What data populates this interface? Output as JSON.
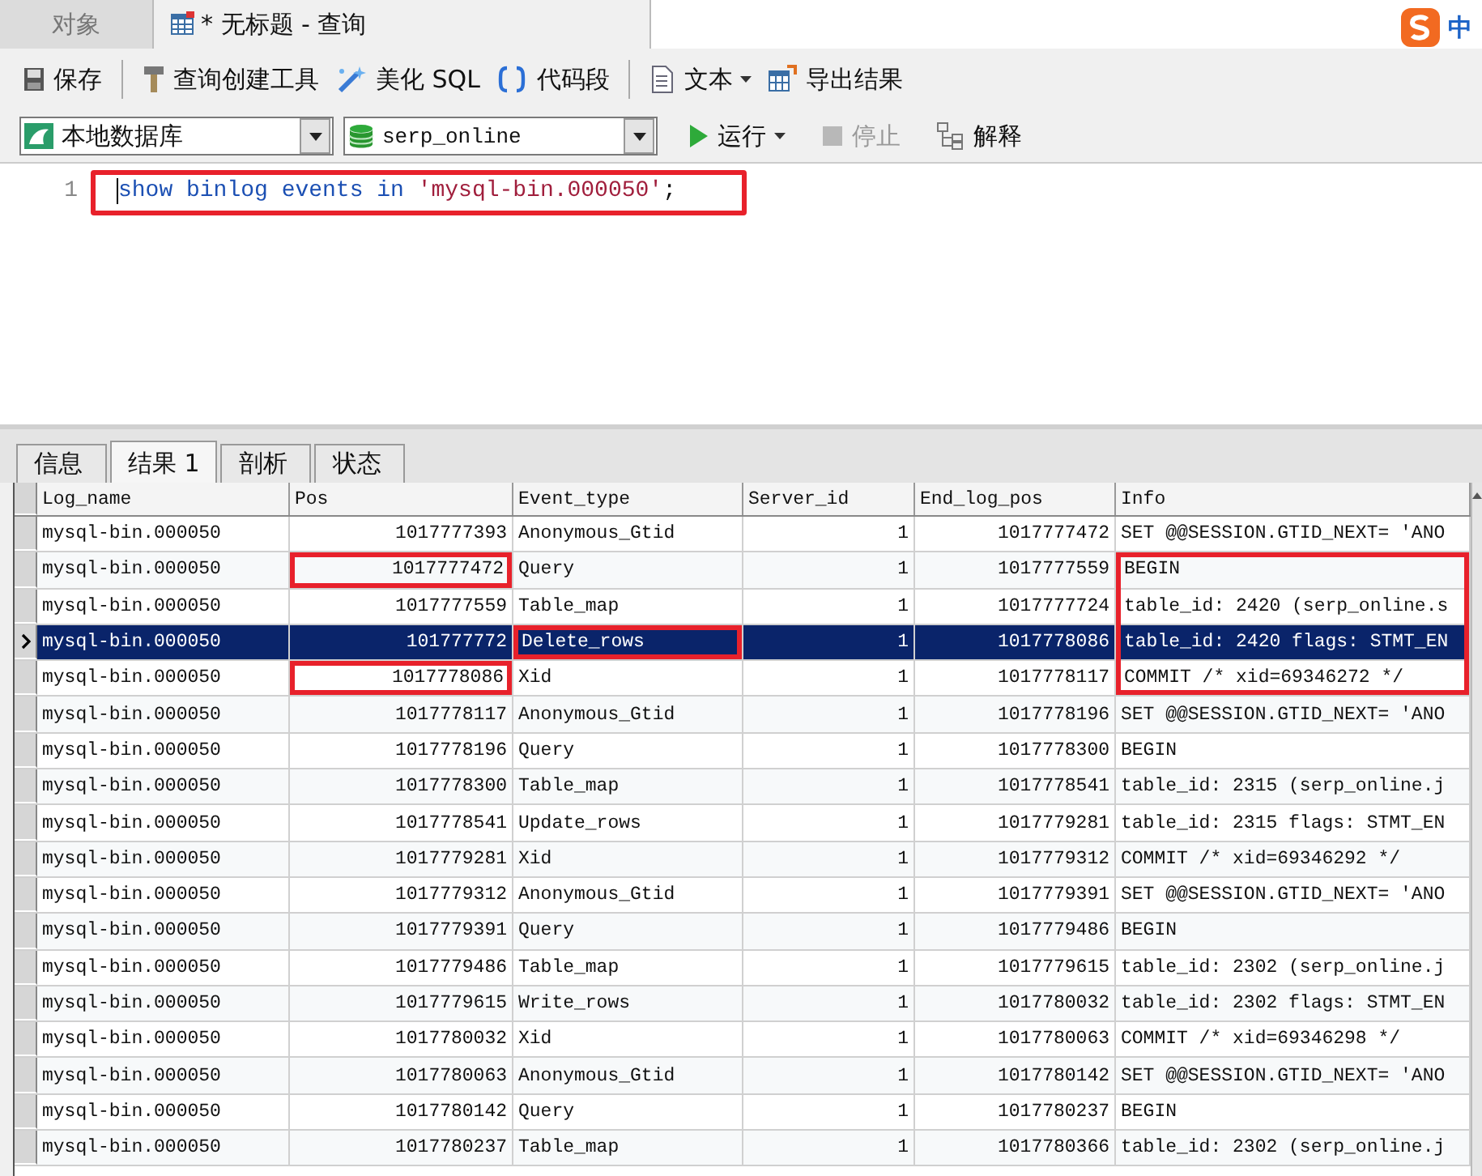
{
  "window_tabs": [
    {
      "label": "对象",
      "kind": "plain",
      "selected": false
    },
    {
      "label": "* 无标题 - 查询",
      "kind": "query",
      "selected": true
    }
  ],
  "ime": {
    "label": "中"
  },
  "toolbar": [
    {
      "kind": "save",
      "label": "保存"
    },
    {
      "kind": "builder",
      "label": "查询创建工具"
    },
    {
      "kind": "beautify",
      "label": "美化 SQL"
    },
    {
      "kind": "snippet",
      "label": "代码段"
    },
    {
      "kind": "text",
      "label": "文本",
      "dropdown": true
    },
    {
      "kind": "export",
      "label": "导出结果"
    }
  ],
  "connection": {
    "value": "本地数据库"
  },
  "database": {
    "value": "serp_online"
  },
  "run_bar": [
    {
      "kind": "run",
      "label": "运行",
      "dropdown": true,
      "disabled": false
    },
    {
      "kind": "stop",
      "label": "停止",
      "dropdown": false,
      "disabled": true
    },
    {
      "kind": "explain",
      "label": "解释",
      "dropdown": false,
      "disabled": false
    }
  ],
  "editor": {
    "lines": [
      {
        "number": "1",
        "annotated": true,
        "tokens": [
          {
            "kind": "keyword",
            "text": "show binlog events in "
          },
          {
            "kind": "string",
            "text": "'mysql-bin.000050'"
          },
          {
            "kind": "plain",
            "text": ";"
          }
        ]
      }
    ]
  },
  "result_tabs": [
    {
      "label": "信息",
      "selected": false
    },
    {
      "label": "结果 1",
      "selected": true
    },
    {
      "label": "剖析",
      "selected": false
    },
    {
      "label": "状态",
      "selected": false
    }
  ],
  "table": {
    "columns": [
      {
        "label": "Log_name",
        "kind": "text"
      },
      {
        "label": "Pos",
        "kind": "number"
      },
      {
        "label": "Event_type",
        "kind": "text"
      },
      {
        "label": "Server_id",
        "kind": "number"
      },
      {
        "label": "End_log_pos",
        "kind": "number"
      },
      {
        "label": "Info",
        "kind": "text"
      }
    ],
    "rows": [
      {
        "cells": [
          "mysql-bin.000050",
          "1017777393",
          "Anonymous_Gtid",
          "1",
          "1017777472",
          "SET @@SESSION.GTID_NEXT= 'ANO"
        ],
        "selected": false,
        "marked": [
          false,
          false,
          false,
          false,
          false,
          false
        ]
      },
      {
        "cells": [
          "mysql-bin.000050",
          "1017777472",
          "Query",
          "1",
          "1017777559",
          "BEGIN"
        ],
        "selected": false,
        "marked": [
          false,
          true,
          false,
          false,
          false,
          true
        ]
      },
      {
        "cells": [
          "mysql-bin.000050",
          "1017777559",
          "Table_map",
          "1",
          "1017777724",
          "table_id: 2420 (serp_online.s"
        ],
        "selected": false,
        "marked": [
          false,
          false,
          false,
          false,
          false,
          true
        ]
      },
      {
        "cells": [
          "mysql-bin.000050",
          "101777772",
          "Delete_rows",
          "1",
          "1017778086",
          "table_id: 2420 flags: STMT_EN"
        ],
        "selected": true,
        "marked": [
          false,
          false,
          true,
          false,
          false,
          true
        ]
      },
      {
        "cells": [
          "mysql-bin.000050",
          "1017778086",
          "Xid",
          "1",
          "1017778117",
          "COMMIT /* xid=69346272 */"
        ],
        "selected": false,
        "marked": [
          false,
          true,
          false,
          false,
          false,
          true
        ]
      },
      {
        "cells": [
          "mysql-bin.000050",
          "1017778117",
          "Anonymous_Gtid",
          "1",
          "1017778196",
          "SET @@SESSION.GTID_NEXT= 'ANO"
        ],
        "selected": false,
        "marked": [
          false,
          false,
          false,
          false,
          false,
          false
        ]
      },
      {
        "cells": [
          "mysql-bin.000050",
          "1017778196",
          "Query",
          "1",
          "1017778300",
          "BEGIN"
        ],
        "selected": false,
        "marked": [
          false,
          false,
          false,
          false,
          false,
          false
        ]
      },
      {
        "cells": [
          "mysql-bin.000050",
          "1017778300",
          "Table_map",
          "1",
          "1017778541",
          "table_id: 2315 (serp_online.j"
        ],
        "selected": false,
        "marked": [
          false,
          false,
          false,
          false,
          false,
          false
        ]
      },
      {
        "cells": [
          "mysql-bin.000050",
          "1017778541",
          "Update_rows",
          "1",
          "1017779281",
          "table_id: 2315 flags: STMT_EN"
        ],
        "selected": false,
        "marked": [
          false,
          false,
          false,
          false,
          false,
          false
        ]
      },
      {
        "cells": [
          "mysql-bin.000050",
          "1017779281",
          "Xid",
          "1",
          "1017779312",
          "COMMIT /* xid=69346292 */"
        ],
        "selected": false,
        "marked": [
          false,
          false,
          false,
          false,
          false,
          false
        ]
      },
      {
        "cells": [
          "mysql-bin.000050",
          "1017779312",
          "Anonymous_Gtid",
          "1",
          "1017779391",
          "SET @@SESSION.GTID_NEXT= 'ANO"
        ],
        "selected": false,
        "marked": [
          false,
          false,
          false,
          false,
          false,
          false
        ]
      },
      {
        "cells": [
          "mysql-bin.000050",
          "1017779391",
          "Query",
          "1",
          "1017779486",
          "BEGIN"
        ],
        "selected": false,
        "marked": [
          false,
          false,
          false,
          false,
          false,
          false
        ]
      },
      {
        "cells": [
          "mysql-bin.000050",
          "1017779486",
          "Table_map",
          "1",
          "1017779615",
          "table_id: 2302 (serp_online.j"
        ],
        "selected": false,
        "marked": [
          false,
          false,
          false,
          false,
          false,
          false
        ]
      },
      {
        "cells": [
          "mysql-bin.000050",
          "1017779615",
          "Write_rows",
          "1",
          "1017780032",
          "table_id: 2302 flags: STMT_EN"
        ],
        "selected": false,
        "marked": [
          false,
          false,
          false,
          false,
          false,
          false
        ]
      },
      {
        "cells": [
          "mysql-bin.000050",
          "1017780032",
          "Xid",
          "1",
          "1017780063",
          "COMMIT /* xid=69346298 */"
        ],
        "selected": false,
        "marked": [
          false,
          false,
          false,
          false,
          false,
          false
        ]
      },
      {
        "cells": [
          "mysql-bin.000050",
          "1017780063",
          "Anonymous_Gtid",
          "1",
          "1017780142",
          "SET @@SESSION.GTID_NEXT= 'ANO"
        ],
        "selected": false,
        "marked": [
          false,
          false,
          false,
          false,
          false,
          false
        ]
      },
      {
        "cells": [
          "mysql-bin.000050",
          "1017780142",
          "Query",
          "1",
          "1017780237",
          "BEGIN"
        ],
        "selected": false,
        "marked": [
          false,
          false,
          false,
          false,
          false,
          false
        ]
      },
      {
        "cells": [
          "mysql-bin.000050",
          "1017780237",
          "Table_map",
          "1",
          "1017780366",
          "table_id: 2302 (serp_online.j"
        ],
        "selected": false,
        "marked": [
          false,
          false,
          false,
          false,
          false,
          false
        ]
      }
    ]
  }
}
